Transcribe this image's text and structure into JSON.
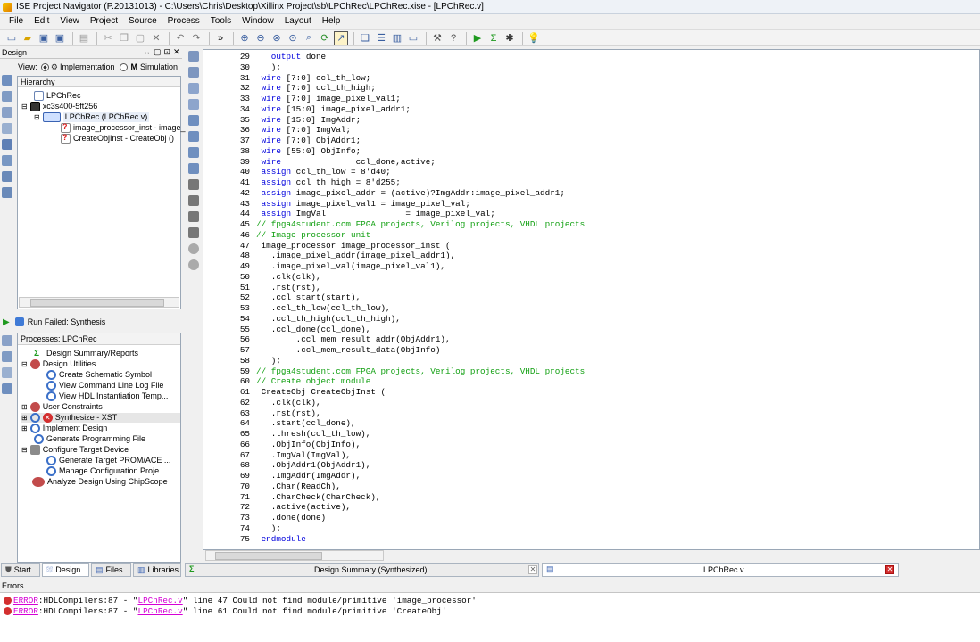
{
  "window": {
    "title": "ISE Project Navigator (P.20131013) - C:\\Users\\Chris\\Desktop\\Xillinx Project\\sb\\LPChRec\\LPChRec.xise - [LPChRec.v]"
  },
  "menu": [
    "File",
    "Edit",
    "View",
    "Project",
    "Source",
    "Process",
    "Tools",
    "Window",
    "Layout",
    "Help"
  ],
  "design_panel": {
    "title": "Design",
    "view_label": "View:",
    "view_impl": "Implementation",
    "view_sim": "Simulation",
    "hierarchy_label": "Hierarchy",
    "hierarchy": [
      {
        "label": "LPChRec"
      },
      {
        "label": "xc3s400-5ft256"
      },
      {
        "label": "LPChRec (LPChRec.v)"
      },
      {
        "label": "image_processor_inst - image_"
      },
      {
        "label": "CreateObjInst - CreateObj ()"
      }
    ],
    "run_status": "Run Failed: Synthesis",
    "processes_label": "Processes: LPChRec",
    "processes": [
      {
        "label": "Design Summary/Reports"
      },
      {
        "label": "Design Utilities"
      },
      {
        "label": "Create Schematic Symbol"
      },
      {
        "label": "View Command Line Log File"
      },
      {
        "label": "View HDL Instantiation Temp..."
      },
      {
        "label": "User Constraints"
      },
      {
        "label": "Synthesize - XST"
      },
      {
        "label": "Implement Design"
      },
      {
        "label": "Generate Programming File"
      },
      {
        "label": "Configure Target Device"
      },
      {
        "label": "Generate Target PROM/ACE ..."
      },
      {
        "label": "Manage Configuration Proje..."
      },
      {
        "label": "Analyze Design Using ChipScope"
      }
    ]
  },
  "bottom_tabs": {
    "start": "Start",
    "design": "Design",
    "files": "Files",
    "libraries": "Libraries"
  },
  "editor_tabs": {
    "summary": "Design Summary (Synthesized)",
    "file": "LPChRec.v"
  },
  "errors": {
    "title": "Errors",
    "lines": [
      {
        "word": "ERROR",
        "pre": ":HDLCompilers:87 - \"",
        "file": "LPChRec.v",
        "post": "\" line 47 Could not find module/primitive 'image_processor'"
      },
      {
        "word": "ERROR",
        "pre": ":HDLCompilers:87 - \"",
        "file": "LPChRec.v",
        "post": "\" line 61 Could not find module/primitive 'CreateObj'"
      }
    ]
  },
  "code": [
    {
      "n": "29",
      "t": "   output done",
      "kw": "output"
    },
    {
      "n": "30",
      "t": "   );"
    },
    {
      "n": "31",
      "t": " wire [7:0] ccl_th_low;",
      "kw": "wire"
    },
    {
      "n": "32",
      "t": " wire [7:0] ccl_th_high;",
      "kw": "wire"
    },
    {
      "n": "33",
      "t": " wire [7:0] image_pixel_val1;",
      "kw": "wire"
    },
    {
      "n": "34",
      "t": " wire [15:0] image_pixel_addr1;",
      "kw": "wire"
    },
    {
      "n": "35",
      "t": " wire [15:0] ImgAddr;",
      "kw": "wire"
    },
    {
      "n": "36",
      "t": " wire [7:0] ImgVal;",
      "kw": "wire"
    },
    {
      "n": "37",
      "t": " wire [7:0] ObjAddr1;",
      "kw": "wire"
    },
    {
      "n": "38",
      "t": " wire [55:0] ObjInfo;",
      "kw": "wire"
    },
    {
      "n": "39",
      "t": " wire               ccl_done,active;",
      "kw": "wire"
    },
    {
      "n": "40",
      "t": " assign ccl_th_low = 8'd40;",
      "kw": "assign"
    },
    {
      "n": "41",
      "t": " assign ccl_th_high = 8'd255;",
      "kw": "assign"
    },
    {
      "n": "42",
      "t": " assign image_pixel_addr = (active)?ImgAddr:image_pixel_addr1;",
      "kw": "assign"
    },
    {
      "n": "43",
      "t": " assign image_pixel_val1 = image_pixel_val;",
      "kw": "assign"
    },
    {
      "n": "44",
      "t": " assign ImgVal                = image_pixel_val;",
      "kw": "assign"
    },
    {
      "n": "45",
      "t": "// fpga4student.com FPGA projects, Verilog projects, VHDL projects",
      "cm": true
    },
    {
      "n": "46",
      "t": "// Image processor unit",
      "cm": true
    },
    {
      "n": "47",
      "t": " image_processor image_processor_inst ("
    },
    {
      "n": "48",
      "t": "   .image_pixel_addr(image_pixel_addr1),"
    },
    {
      "n": "49",
      "t": "   .image_pixel_val(image_pixel_val1),"
    },
    {
      "n": "50",
      "t": "   .clk(clk),"
    },
    {
      "n": "51",
      "t": "   .rst(rst),"
    },
    {
      "n": "52",
      "t": "   .ccl_start(start),"
    },
    {
      "n": "53",
      "t": "   .ccl_th_low(ccl_th_low),"
    },
    {
      "n": "54",
      "t": "   .ccl_th_high(ccl_th_high),"
    },
    {
      "n": "55",
      "t": "   .ccl_done(ccl_done),"
    },
    {
      "n": "56",
      "t": "        .ccl_mem_result_addr(ObjAddr1),"
    },
    {
      "n": "57",
      "t": "        .ccl_mem_result_data(ObjInfo)"
    },
    {
      "n": "58",
      "t": "   );"
    },
    {
      "n": "59",
      "t": "// fpga4student.com FPGA projects, Verilog projects, VHDL projects",
      "cm": true
    },
    {
      "n": "60",
      "t": "// Create object module",
      "cm": true
    },
    {
      "n": "61",
      "t": " CreateObj CreateObjInst ("
    },
    {
      "n": "62",
      "t": "   .clk(clk),"
    },
    {
      "n": "63",
      "t": "   .rst(rst),"
    },
    {
      "n": "64",
      "t": "   .start(ccl_done),"
    },
    {
      "n": "65",
      "t": "   .thresh(ccl_th_low),"
    },
    {
      "n": "66",
      "t": "   .ObjInfo(ObjInfo),"
    },
    {
      "n": "67",
      "t": "   .ImgVal(ImgVal),"
    },
    {
      "n": "68",
      "t": "   .ObjAddr1(ObjAddr1),"
    },
    {
      "n": "69",
      "t": "   .ImgAddr(ImgAddr),"
    },
    {
      "n": "70",
      "t": "   .Char(ReadCh),"
    },
    {
      "n": "71",
      "t": "   .CharCheck(CharCheck),"
    },
    {
      "n": "72",
      "t": "   .active(active),"
    },
    {
      "n": "73",
      "t": "   .done(done)"
    },
    {
      "n": "74",
      "t": "   );"
    },
    {
      "n": "75",
      "t": " endmodule",
      "kw": "endmodule"
    }
  ]
}
